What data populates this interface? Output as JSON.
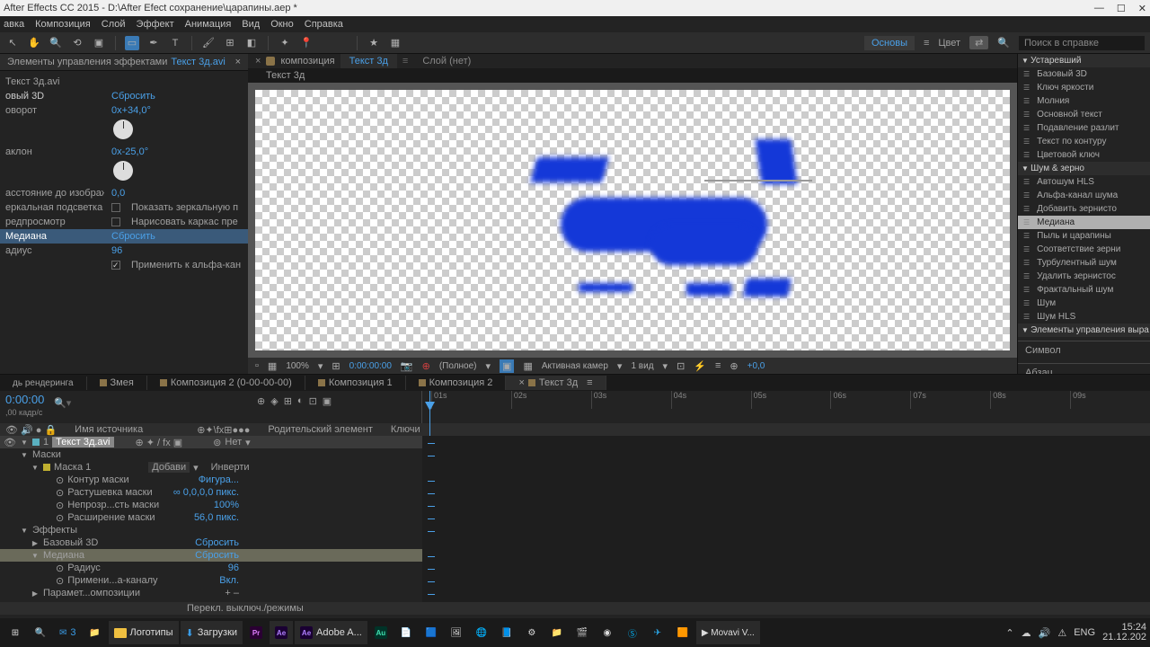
{
  "title": "After Effects CC 2015 - D:\\After Efect сохранение\\царапины.aep *",
  "menu": [
    "авка",
    "Композиция",
    "Слой",
    "Эффект",
    "Анимация",
    "Вид",
    "Окно",
    "Справка"
  ],
  "toolbar_right": {
    "workspace": "Основы",
    "color": "Цвет",
    "search": "Поиск в справке"
  },
  "effects_panel": {
    "tab": "Элементы управления эффектами",
    "tab_item": "Текст 3д.avi",
    "layer": "Текст 3д.avi",
    "fx1": {
      "name": "овый 3D",
      "reset": "Сбросить",
      "rot_lbl": "оворот",
      "rot_val": "0x+34,0°",
      "tilt_lbl": "аклон",
      "tilt_val": "0x-25,0°",
      "dist_lbl": "асстояние до изображени",
      "dist_val": "0,0",
      "spec_lbl": "еркальная подсветка",
      "spec_opt": "Показать зеркальную п",
      "prev_lbl": "редпросмотр",
      "prev_opt": "Нарисовать каркас пре"
    },
    "fx2": {
      "name": "Медиана",
      "reset": "Сбросить",
      "radius_lbl": "адиус",
      "radius_val": "96",
      "alpha": "Применить к альфа-кан"
    }
  },
  "comp": {
    "tab": "композиция",
    "tab_name": "Текст 3д",
    "layer_tab": "Слой (нет)",
    "chip": "Текст 3д"
  },
  "viewbar": {
    "zoom": "100%",
    "time": "0:00:00:00",
    "res": "(Полное)",
    "cam": "Активная камер",
    "views": "1 вид",
    "exp": "+0,0"
  },
  "right": {
    "sec1": "Устаревший",
    "items1": [
      "Базовый 3D",
      "Ключ яркости",
      "Молния",
      "Основной текст",
      "Подавление разлит",
      "Текст по контуру",
      "Цветовой ключ"
    ],
    "sec2": "Шум & зерно",
    "items2": [
      "Автошум HLS",
      "Альфа-канал шума",
      "Добавить зернисто",
      "Медиана",
      "Пыль и царапины",
      "Соответствие зерни",
      "Турбулентный шум",
      "Удалить зернистос",
      "Фрактальный шум",
      "Шум",
      "Шум HLS"
    ],
    "sec3": "Элементы управления выра",
    "box1": "Символ",
    "box2": "Абзац"
  },
  "timeline": {
    "render": "дь рендеринга",
    "tabs": [
      "Змея",
      "Композиция 2 (0-00-00-00)",
      "Композиция 1",
      "Композиция 2",
      "Текст 3д"
    ],
    "time": "0:00:00",
    "fps": ",00 кадр/с",
    "cols": {
      "src": "Имя источника",
      "parent": "Родительский элемент",
      "keys": "Ключи"
    },
    "marks": [
      "01s",
      "02s",
      "03s",
      "04s",
      "05s",
      "06s",
      "07s",
      "08s",
      "09s"
    ],
    "layer": {
      "num": "1",
      "name": "Текст 3д.avi",
      "parent": "Нет"
    },
    "masks": "Маски",
    "mask1": "Маска 1",
    "mode": "Добави",
    "invert": "Инверти",
    "props": [
      {
        "n": "Контур маски",
        "v": "Фигура..."
      },
      {
        "n": "Растушевка маски",
        "v": "∞ 0,0,0,0 пикс."
      },
      {
        "n": "Непрозр...сть маски",
        "v": "100%"
      },
      {
        "n": "Расширение маски",
        "v": "56,0 пикс."
      }
    ],
    "fx": "Эффекты",
    "fxrows": [
      {
        "n": "Базовый 3D",
        "v": "Сбросить"
      },
      {
        "n": "Медиана",
        "v": "Сбросить"
      },
      {
        "n": "Радиус",
        "v": "96",
        "sub": true
      },
      {
        "n": "Примени...а-каналу",
        "v": "Вкл.",
        "sub": true
      },
      {
        "n": "Парамет...омпозиции",
        "v": "+  –"
      }
    ],
    "footer": "Перекл. выключ./режимы"
  },
  "taskbar": {
    "items": [
      "Логотипы",
      "Загрузки",
      "Adobe A..."
    ],
    "tray": {
      "lang": "ENG",
      "time": "15:24",
      "date": "21.12.202"
    }
  }
}
